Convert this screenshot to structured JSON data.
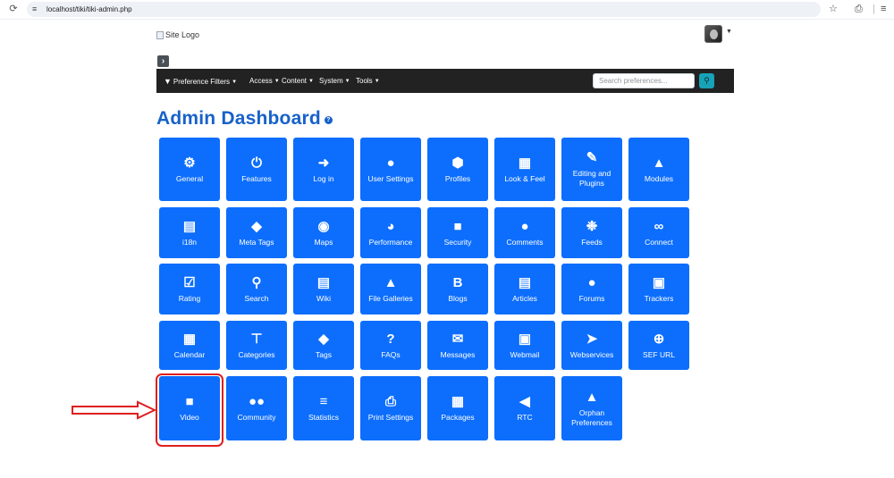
{
  "browser": {
    "url": "localhost/tiki/tiki-admin.php"
  },
  "site": {
    "logo_alt": "Site Logo"
  },
  "nav": {
    "items": [
      "Preference Filters",
      "Access",
      "Content",
      "System",
      "Tools"
    ],
    "search_placeholder": "Search preferences..."
  },
  "page": {
    "title": "Admin Dashboard"
  },
  "tiles": [
    {
      "label": "General",
      "icon": "gear-icon"
    },
    {
      "label": "Features",
      "icon": "power-icon"
    },
    {
      "label": "Log in",
      "icon": "sign-in-icon"
    },
    {
      "label": "User Settings",
      "icon": "user-icon"
    },
    {
      "label": "Profiles",
      "icon": "cube-icon"
    },
    {
      "label": "Look & Feel",
      "icon": "image-icon"
    },
    {
      "label": "Editing and Plugins",
      "icon": "edit-icon"
    },
    {
      "label": "Modules",
      "icon": "shapes-icon"
    },
    {
      "label": "i18n",
      "icon": "language-icon"
    },
    {
      "label": "Meta Tags",
      "icon": "tag-icon"
    },
    {
      "label": "Maps",
      "icon": "map-marker-icon"
    },
    {
      "label": "Performance",
      "icon": "tachometer-icon"
    },
    {
      "label": "Security",
      "icon": "lock-icon"
    },
    {
      "label": "Comments",
      "icon": "comment-icon"
    },
    {
      "label": "Feeds",
      "icon": "rss-icon"
    },
    {
      "label": "Connect",
      "icon": "link-icon"
    },
    {
      "label": "Rating",
      "icon": "checkbox-icon"
    },
    {
      "label": "Search",
      "icon": "search-icon"
    },
    {
      "label": "Wiki",
      "icon": "file-icon"
    },
    {
      "label": "File Galleries",
      "icon": "folder-open-icon"
    },
    {
      "label": "Blogs",
      "icon": "bold-icon"
    },
    {
      "label": "Articles",
      "icon": "newspaper-icon"
    },
    {
      "label": "Forums",
      "icon": "comments-icon"
    },
    {
      "label": "Trackers",
      "icon": "database-icon"
    },
    {
      "label": "Calendar",
      "icon": "calendar-icon"
    },
    {
      "label": "Categories",
      "icon": "sitemap-icon"
    },
    {
      "label": "Tags",
      "icon": "tags-icon"
    },
    {
      "label": "FAQs",
      "icon": "question-icon"
    },
    {
      "label": "Messages",
      "icon": "envelope-icon"
    },
    {
      "label": "Webmail",
      "icon": "inbox-icon"
    },
    {
      "label": "Webservices",
      "icon": "mouse-pointer-icon"
    },
    {
      "label": "SEF URL",
      "icon": "search-plus-icon"
    },
    {
      "label": "Video",
      "icon": "video-icon"
    },
    {
      "label": "Community",
      "icon": "users-icon"
    },
    {
      "label": "Statistics",
      "icon": "chart-icon"
    },
    {
      "label": "Print Settings",
      "icon": "print-icon"
    },
    {
      "label": "Packages",
      "icon": "gift-icon"
    },
    {
      "label": "RTC",
      "icon": "bullhorn-icon"
    },
    {
      "label": "Orphan Preferences",
      "icon": "warning-icon"
    }
  ]
}
